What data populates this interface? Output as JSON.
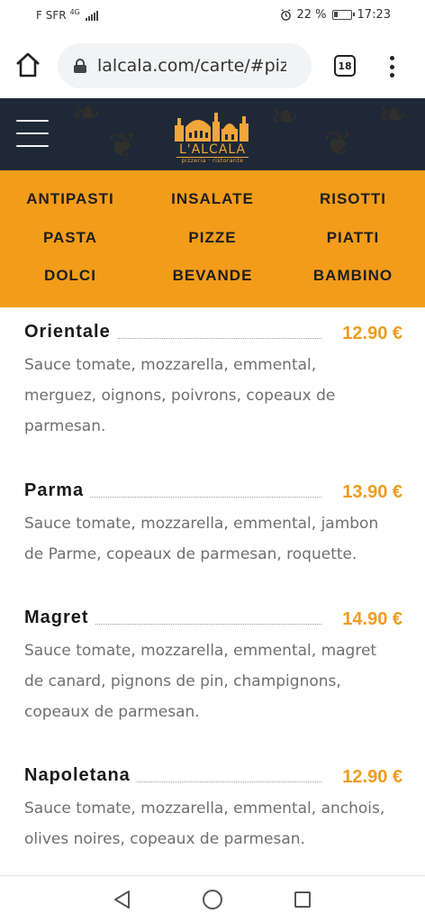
{
  "status_bar": {
    "carrier": "F SFR",
    "network": "4G",
    "battery_percent": "22 %",
    "time": "17:23"
  },
  "browser": {
    "url": "lalcala.com/carte/#pizzas",
    "tab_count": "18"
  },
  "header": {
    "logo_name": "L'ALCALA",
    "logo_tagline": "pizzeria · ristorante",
    "logo_color": "#f0a63a",
    "background": "#1f2836"
  },
  "categories": {
    "color": "#f39c1a",
    "items": [
      "ANTIPASTI",
      "INSALATE",
      "RISOTTI",
      "PASTA",
      "PIZZE",
      "PIATTI",
      "DOLCI",
      "BEVANDE",
      "BAMBINO"
    ]
  },
  "menu": {
    "price_color": "#ef9c1e",
    "items": [
      {
        "name": "Orientale",
        "price": "12.90 €",
        "desc_lines": [
          "Sauce tomate, mozzarella, emmental,",
          "merguez, oignons, poivrons, copeaux de",
          "parmesan."
        ]
      },
      {
        "name": "Parma",
        "price": "13.90 €",
        "desc_lines": [
          "Sauce tomate, mozzarella, emmental, jambon",
          "de Parme, copeaux de parmesan, roquette."
        ]
      },
      {
        "name": "Magret",
        "price": "14.90 €",
        "desc_lines": [
          "Sauce tomate, mozzarella, emmental, magret",
          "de canard, pignons de pin, champignons,",
          "copeaux de parmesan."
        ]
      },
      {
        "name": "Napoletana",
        "price": "12.90 €",
        "desc_lines": [
          "Sauce tomate, mozzarella, emmental, anchois,",
          "olives noires, copeaux de parmesan."
        ]
      }
    ]
  },
  "icons": {
    "home": "home-icon",
    "lock": "lock-icon",
    "tabs": "tabs-icon",
    "overflow": "more-vert-icon",
    "hamburger": "hamburger-menu-icon",
    "back": "back-triangle-icon",
    "home_nav": "home-circle-icon",
    "recents": "recents-square-icon"
  }
}
